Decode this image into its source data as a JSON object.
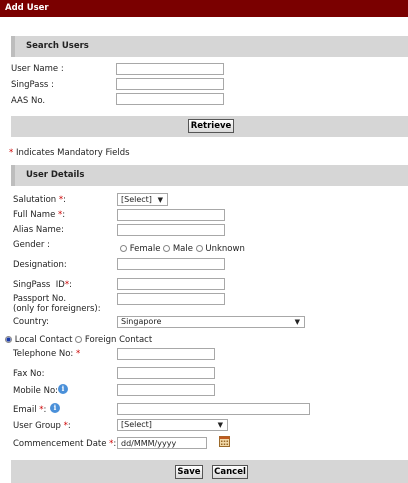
{
  "title": "Add User",
  "search_section": {
    "heading": "Search Users",
    "fields": [
      {
        "label": "User Name :",
        "value": ""
      },
      {
        "label": "SingPass :",
        "value": ""
      },
      {
        "label": "AAS No.",
        "value": ""
      }
    ],
    "retrieve_label": "Retrieve"
  },
  "mandatory_note": {
    "star": "*",
    "text": " Indicates Mandatory Fields"
  },
  "details_section": {
    "heading": "User Details",
    "salutation": {
      "label": "Salutation ",
      "req": "*",
      "colon": ":",
      "value": "[Select]"
    },
    "full_name": {
      "label": "Full Name ",
      "req": "*",
      "colon": ":",
      "value": ""
    },
    "alias_name": {
      "label": "Alias Name:",
      "value": ""
    },
    "gender": {
      "label": "Gender :",
      "options": [
        "Female",
        "Male",
        "Unknown"
      ]
    },
    "designation": {
      "label": "Designation:",
      "value": ""
    },
    "singpass_id": {
      "label": "SingPass  ID",
      "req": "*",
      "colon": ":",
      "value": ""
    },
    "passport": {
      "label_line1": "Passport No.",
      "label_line2": "(only for foreigners):",
      "value": ""
    },
    "country": {
      "label": "Country:",
      "value": "Singapore"
    },
    "contact_type": {
      "options": [
        "Local Contact",
        "Foreign Contact"
      ],
      "selected": "Local Contact"
    },
    "telephone": {
      "label": "Telephone No: ",
      "req": "*",
      "value": ""
    },
    "fax": {
      "label": "Fax No:",
      "value": ""
    },
    "mobile": {
      "label": "Mobile No:",
      "value": ""
    },
    "email": {
      "label": "Email ",
      "req": "*",
      "colon": ":",
      "value": ""
    },
    "user_group": {
      "label": "User Group ",
      "req": "*",
      "colon": ":",
      "value": "[Select]"
    },
    "commencement": {
      "label": "Commencement Date ",
      "req": "*",
      "colon": ":",
      "value": "dd/MMM/yyyy"
    }
  },
  "footer": {
    "save_label": "Save",
    "cancel_label": "Cancel"
  },
  "colors": {
    "titlebar": "#7a0000",
    "section": "#d6d6d6",
    "required": "#cc0000",
    "info": "#4a90d9"
  }
}
